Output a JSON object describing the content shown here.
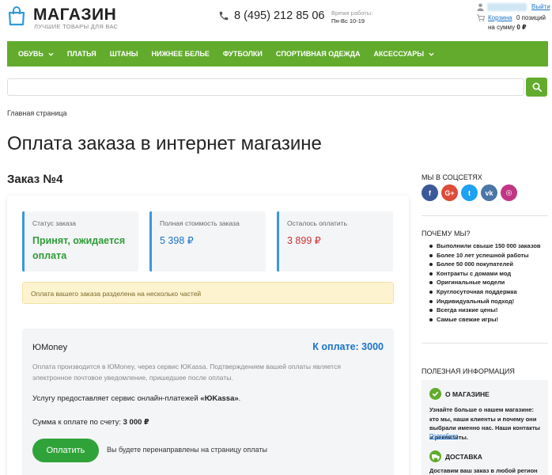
{
  "header": {
    "logo_title": "МАГАЗИН",
    "logo_subtitle": "ЛУЧШИЕ ТОВАРЫ ДЛЯ ВАС",
    "phone": "8 (495) 212 85 06",
    "worktime_label": "Время работы:",
    "worktime": "Пн-Вс 10-19",
    "logout": "Выйти",
    "cart_label": "Корзина",
    "cart_count": "0 позиций",
    "cart_sum_prefix": "на сумму",
    "cart_sum": "0 ₽"
  },
  "nav": {
    "items": [
      {
        "label": "ОБУВЬ",
        "dropdown": true
      },
      {
        "label": "ПЛАТЬЯ",
        "dropdown": false
      },
      {
        "label": "ШТАНЫ",
        "dropdown": false
      },
      {
        "label": "НИЖНЕЕ БЕЛЬЕ",
        "dropdown": false
      },
      {
        "label": "ФУТБОЛКИ",
        "dropdown": false
      },
      {
        "label": "СПОРТИВНАЯ ОДЕЖДА",
        "dropdown": false
      },
      {
        "label": "АКСЕССУАРЫ",
        "dropdown": true
      }
    ]
  },
  "search": {
    "value": "",
    "placeholder": ""
  },
  "breadcrumb": "Главная страница",
  "page_title": "Оплата заказа в интернет магазине",
  "order": {
    "title": "Заказ №4",
    "stats": [
      {
        "label": "Статус заказа",
        "value": "Принят, ожидается оплата"
      },
      {
        "label": "Полная стоимость заказа",
        "value": "5 398 ₽"
      },
      {
        "label": "Осталось оплатить",
        "value": "3 899 ₽"
      }
    ],
    "notice": "Оплата вашего заказа разделена на несколько частей",
    "payment": {
      "name": "ЮMoney",
      "amount_label": "К оплате: 3000",
      "description": "Оплата производится в ЮMoney, через сервис ЮKassa. Подтверждением вашей оплаты является электронное почтовое уведомление, пришедшее после оплаты.",
      "provider_prefix": "Услугу предоставляет сервис онлайн-платежей",
      "provider_name": "«ЮKassa»",
      "provider_suffix": ".",
      "sum_prefix": "Сумма к оплате по счету:",
      "sum_value": "3 000 ₽",
      "button": "Оплатить",
      "redirect_note": "Вы будете перенаправлены на страницу оплаты"
    }
  },
  "sidebar": {
    "social_heading": "МЫ В СОЦСЕТЯХ",
    "socials": [
      {
        "icon": "facebook-icon",
        "glyph": "f",
        "color": "#3b5998"
      },
      {
        "icon": "google-plus-icon",
        "glyph": "G+",
        "color": "#dd4b39"
      },
      {
        "icon": "twitter-icon",
        "glyph": "t",
        "color": "#1da1f2"
      },
      {
        "icon": "vk-icon",
        "glyph": "vk",
        "color": "#4a76a8"
      },
      {
        "icon": "instagram-icon",
        "glyph": "◎",
        "color": "#c13584"
      }
    ],
    "why_heading": "ПОЧЕМУ МЫ?",
    "why_items": [
      "Выполнили свыше 150 000 заказов",
      "Более 10 лет успешной работы",
      "Более 50 000 покупателей",
      "Контракты с домами мод",
      "Оригинальные модели",
      "Круглосуточная поддержка",
      "Индивидуальный подход!",
      "Всегда низкие цены!",
      "Самые свежие игры!"
    ],
    "info_heading": "ПОЛЕЗНАЯ ИНФОРМАЦИЯ",
    "about_title": "О МАГАЗИНЕ",
    "about_text": "Узнайте больше о нашем магазине: кто мы, наши клиенты и почему они выбрали именно нас. Наши контакты и реквизиты.",
    "about_more": "Подробнее",
    "delivery_title": "ДОСТАВКА",
    "delivery_text": "Доставим ваш заказ в любой регион"
  },
  "colors": {
    "brand_green": "#62ab2d",
    "pay_button": "#2fa33a",
    "link_blue": "#1a73c9",
    "alert_red": "#d03030"
  }
}
